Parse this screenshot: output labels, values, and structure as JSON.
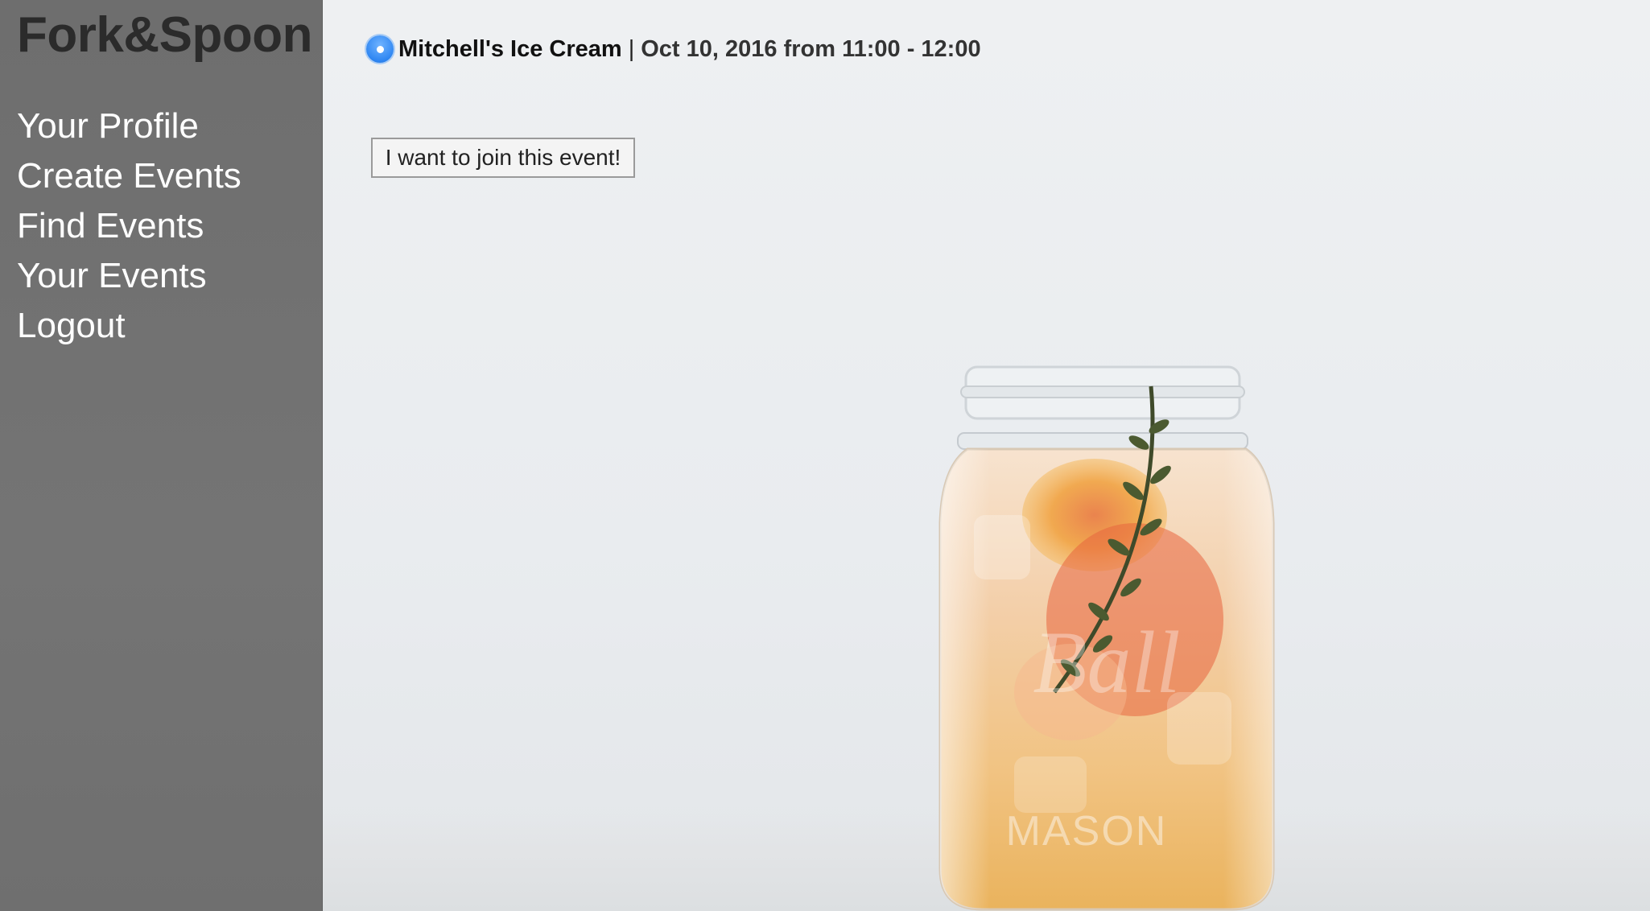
{
  "sidebar": {
    "brand": "Fork&Spoon",
    "nav": [
      {
        "label": "Your Profile"
      },
      {
        "label": "Create Events"
      },
      {
        "label": "Find Events"
      },
      {
        "label": "Your Events"
      },
      {
        "label": "Logout"
      }
    ]
  },
  "event": {
    "title": "Mitchell's Ice Cream",
    "separator": "|",
    "time": "Oct 10, 2016 from 11:00 - 12:00",
    "selected": true
  },
  "actions": {
    "join_label": "I want to join this event!"
  },
  "background": {
    "icon": "mason-jar-drink-photo"
  },
  "colors": {
    "sidebar": "#707070",
    "radio_accent": "#2f86f2",
    "page_bg": "#eceef0"
  }
}
